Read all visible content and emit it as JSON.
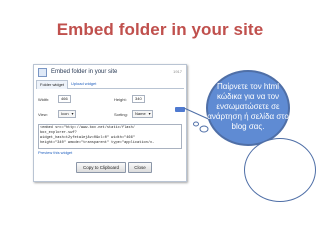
{
  "slide": {
    "title": "Embed folder in your site"
  },
  "widget": {
    "title": "Embed folder in your site",
    "meta": "1917",
    "tabs": [
      "Folder widget",
      "Upload widget"
    ],
    "labels": {
      "width": "Width:",
      "height": "Height:",
      "view": "View:",
      "sorting": "Sorting:"
    },
    "values": {
      "width": "466",
      "height": "340",
      "view": "Icon",
      "sorting": "Name"
    },
    "code": "<embed src=\"http://www.box.net/static/flash/\nbox_explorer.swf?\nwidget_hash=t2yfeta1ej&v=0&cl=0\" width=\"466\"\nheight=\"340\" wmode=\"transparent\" type=\"application/x-",
    "preview_link": "Preview this widget",
    "buttons": {
      "copy": "Copy to Clipboard",
      "close": "Close"
    }
  },
  "callout": {
    "text": "Παίρνετε τον html κώδικα για να τον ενσωματώσετε σε ανάρτηση ή σελίδα στο blog σας."
  },
  "colors": {
    "title": "#c0504d",
    "bubble_fill": "#5f8bd3",
    "bubble_stroke": "#4f6fa7"
  }
}
